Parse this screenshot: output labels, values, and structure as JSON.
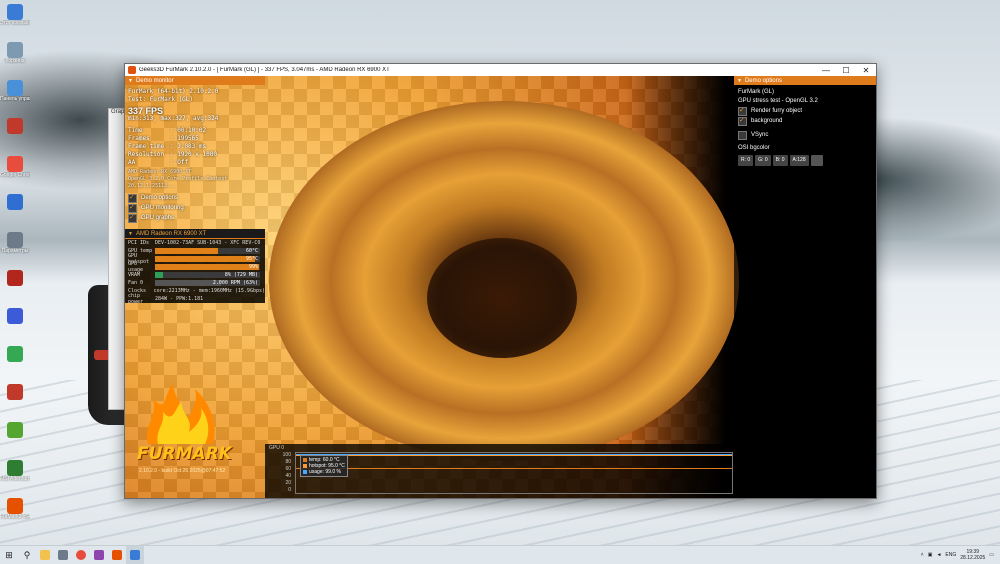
{
  "window": {
    "title": "Geeks3D FurMark 2.10.2.0 - [ FurMark (GL) ] - 337 FPS, 3.047ms - AMD Radeon RX 6900 XT",
    "minimize": "—",
    "maximize": "☐",
    "close": "✕"
  },
  "demo_monitor": {
    "header": "Demo monitor",
    "app_line": "FurMark (64-bit) 2.10.2.0",
    "test_line": "Test: FurMark (GL)",
    "fps": "337 FPS",
    "fps_stats": "min:313, max:327, avg:324",
    "stats": [
      {
        "k": "Time",
        "v": ": 00:10:02"
      },
      {
        "k": "Frames",
        "v": ": 199565"
      },
      {
        "k": "Frame time",
        "v": ": 3.083 ms"
      },
      {
        "k": "Resolution",
        "v": ": 1920 x 1080"
      },
      {
        "k": "AA",
        "v": ": Off"
      }
    ],
    "renderer": "AMD Radeon RX 6900 XT",
    "gl_version": "OpenGL 3.2.0 Core Profile Context 20.12.1.25113...",
    "options": [
      {
        "label": "Demo options",
        "checked": true
      },
      {
        "label": "GPU monitoring",
        "checked": true
      },
      {
        "label": "GPU graphs",
        "checked": true
      }
    ]
  },
  "gpu_monitor": {
    "header": "AMD Radeon RX 6900 XT",
    "pci": "PCI IDs",
    "pci_value": "DEV-1002-73AF SUB-1043 - XFC REV-C0",
    "rows": [
      {
        "k": "GPU temp",
        "val": "60°C",
        "pct": 0.6
      },
      {
        "k": "GPU hotspot",
        "val": "95°C",
        "pct": 0.95
      },
      {
        "k": "GPU usage",
        "val": "99%",
        "pct": 0.99
      },
      {
        "k": "VRAM",
        "val": "8% (729 MB)",
        "pct": 0.08
      },
      {
        "k": "Fan 0",
        "val": "2.000 RPM (63%)",
        "pct": 0.63
      }
    ],
    "clocks_k": "Clocks",
    "clocks_v": "core:2213MHz - mem:1960MHz (15.9Gbps)",
    "power_k": "chip power",
    "power_v": "284W - PPW:1.181"
  },
  "logo": {
    "text": "FURMARK",
    "sub": "2.10.2.0 - build Oct 26 2025@07:47:52"
  },
  "demo_options": {
    "header": "Demo options",
    "title": "FurMark (GL)",
    "subtitle": "GPU stress test - OpenGL 3.2",
    "options": [
      {
        "label": "Render furry object",
        "checked": true
      },
      {
        "label": "background",
        "checked": true
      }
    ],
    "vsync": {
      "label": "VSync",
      "checked": false
    },
    "bgcolor_label": "OSI bgcolor",
    "bgcolor": [
      "R: 0",
      "G: 0",
      "B: 0",
      "A:128"
    ]
  },
  "graph": {
    "label": "GPU 0",
    "axis": [
      "100",
      "80",
      "60",
      "40",
      "20",
      "0"
    ],
    "legend": [
      {
        "label": "temp: 60.0 °C",
        "color": "#e07b1c"
      },
      {
        "label": "hotspot: 95.0 °C",
        "color": "#ff9933"
      },
      {
        "label": "usage: 99.0 %",
        "color": "#4aa8ff"
      }
    ]
  },
  "desktop_icons": [
    {
      "label": "Этот компьютер",
      "color": "#3a7bd5"
    },
    {
      "label": "Корзина",
      "color": "#7d9ab0"
    },
    {
      "label": "Панель управления",
      "color": "#4a90d9"
    },
    {
      "label": "",
      "color": "#c0392b"
    },
    {
      "label": "Google Chrome",
      "color": "#e74c3c"
    },
    {
      "label": "",
      "color": "#2f6fd1"
    },
    {
      "label": "Параметры",
      "color": "#6c7a89"
    },
    {
      "label": "",
      "color": "#b3261e"
    },
    {
      "label": "",
      "color": "#3b5bd8"
    },
    {
      "label": "",
      "color": "#34a853"
    },
    {
      "label": "",
      "color": "#c0392b"
    },
    {
      "label": "",
      "color": "#55a630"
    },
    {
      "label": "MSI Afterburner",
      "color": "#2e7d32"
    },
    {
      "label": "FurMark2 x64",
      "color": "#e65100"
    }
  ],
  "taskbar": {
    "start": "⊞",
    "search": "⚲",
    "lang": "ENG",
    "time": "19:39",
    "date": "28.12.2025"
  },
  "colors": {
    "accent": "#e07b1c",
    "panel_bg": "#000000"
  }
}
